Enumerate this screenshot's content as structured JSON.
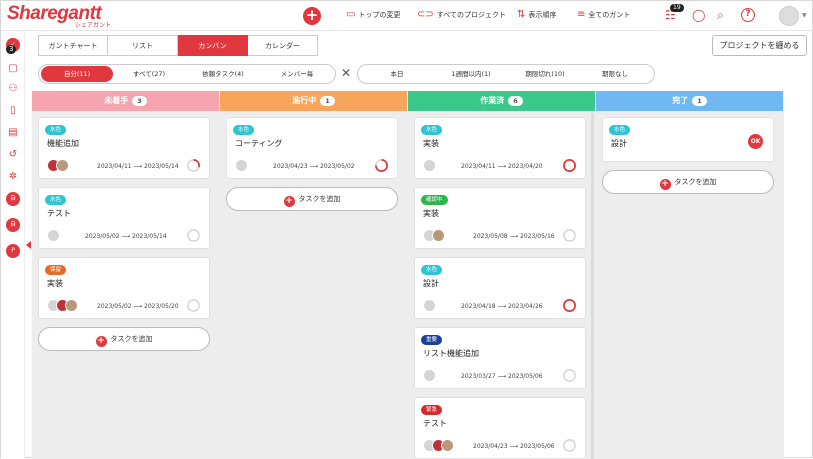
{
  "app": {
    "logo": "Sharegantt",
    "logo_sub": "シェアガント"
  },
  "header": {
    "nav": [
      {
        "label": "トップの変更",
        "icon": "monitor-icon"
      },
      {
        "label": "すべてのプロジェクト",
        "icon": "link-icon"
      },
      {
        "label": "表示順序",
        "icon": "sort-icon"
      },
      {
        "label": "全てのガント",
        "icon": "gantt-icon"
      }
    ],
    "tasks_badge": "19"
  },
  "rail": {
    "badge": "3",
    "items": [
      "P",
      "自",
      "自"
    ]
  },
  "tabs": [
    {
      "label": "ガントチャート",
      "active": false
    },
    {
      "label": "リスト",
      "active": false
    },
    {
      "label": "カンバン",
      "active": true
    },
    {
      "label": "カレンダー",
      "active": false
    }
  ],
  "collapse_button": "プロジェクトを纏める",
  "filters_left": [
    {
      "label": "自分(11)",
      "active": true
    },
    {
      "label": "すべて(27)",
      "active": false
    },
    {
      "label": "依頼タスク(4)",
      "active": false
    },
    {
      "label": "メンバー毎",
      "active": false
    }
  ],
  "filters_right": [
    {
      "label": "本日"
    },
    {
      "label": "1週間以内(1)"
    },
    {
      "label": "期限切れ(10)"
    },
    {
      "label": "期限なし"
    }
  ],
  "add_task_label": "タスクを追加",
  "columns": [
    {
      "title": "未着手",
      "count": "3",
      "color": "#f5a5b0",
      "cards": [
        {
          "tag": "水色",
          "tag_color": "#2cc5d4",
          "title": "機能追加",
          "date": "2023/04/11 ⟶ 2023/05/14",
          "progress": 0.3,
          "ring": "#e0383e",
          "avatars": [
            "red",
            "cat"
          ]
        },
        {
          "tag": "水色",
          "tag_color": "#2cc5d4",
          "title": "テスト",
          "date": "2023/05/02 ⟶ 2023/05/14",
          "progress": 0,
          "ring": "#ccc",
          "avatars": [
            "gray"
          ]
        },
        {
          "tag": "保留",
          "tag_color": "#e86a2a",
          "title": "実装",
          "date": "2023/05/02 ⟶ 2023/05/20",
          "progress": 0,
          "ring": "#ccc",
          "avatars": [
            "gray",
            "red",
            "cat"
          ]
        }
      ]
    },
    {
      "title": "進行中",
      "count": "1",
      "color": "#f7a55a",
      "cards": [
        {
          "tag": "水色",
          "tag_color": "#2cc5d4",
          "title": "コーティング",
          "date": "2023/04/23 ⟶ 2023/05/02",
          "progress": 0.75,
          "ring": "#e0383e",
          "avatars": [
            "gray"
          ]
        }
      ]
    },
    {
      "title": "作業済",
      "count": "6",
      "color": "#3cc88a",
      "cards": [
        {
          "tag": "水色",
          "tag_color": "#2cc5d4",
          "title": "実装",
          "date": "2023/04/11 ⟶ 2023/04/20",
          "progress": 1,
          "ring": "#e0383e",
          "avatars": [
            "gray"
          ]
        },
        {
          "tag": "確認中",
          "tag_color": "#2eb54a",
          "title": "実装",
          "date": "2023/05/08 ⟶ 2023/05/16",
          "progress": 0,
          "ring": "#ccc",
          "avatars": [
            "gray",
            "cat"
          ]
        },
        {
          "tag": "水色",
          "tag_color": "#2cc5d4",
          "title": "設計",
          "date": "2023/04/18 ⟶ 2023/04/26",
          "progress": 1,
          "ring": "#e0383e",
          "avatars": [
            "gray"
          ]
        },
        {
          "tag": "重要",
          "tag_color": "#1c3f9c",
          "title": "リスト機能追加",
          "date": "2023/03/27 ⟶ 2023/05/06",
          "progress": 0,
          "ring": "#ccc",
          "avatars": [
            "gray"
          ]
        },
        {
          "tag": "緊急",
          "tag_color": "#d42a30",
          "title": "テスト",
          "date": "2023/04/23 ⟶ 2023/05/06",
          "progress": 0,
          "ring": "#ccc",
          "avatars": [
            "gray",
            "red",
            "cat"
          ]
        }
      ]
    },
    {
      "title": "完了",
      "count": "1",
      "color": "#6fb8f2",
      "cards": [
        {
          "tag": "水色",
          "tag_color": "#2cc5d4",
          "title": "設計",
          "ok": "OK",
          "avatars": []
        }
      ]
    }
  ]
}
